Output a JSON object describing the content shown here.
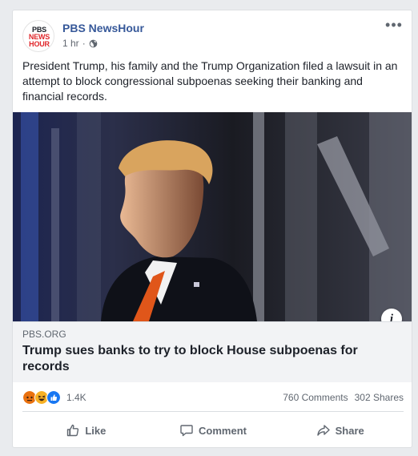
{
  "post": {
    "page_name": "PBS NewsHour",
    "avatar_logo": [
      "PBS",
      "NEWS",
      "HOUR"
    ],
    "time": "1 hr",
    "separator": "·",
    "text": "President Trump, his family and the Trump Organization filed a lawsuit in an attempt to block congressional subpoenas seeking their banking and financial records.",
    "more_icon": "more-horizontal-icon",
    "privacy_icon": "globe-icon"
  },
  "link": {
    "domain": "PBS.ORG",
    "headline": "Trump sues banks to try to block House subpoenas for records",
    "info_label": "i"
  },
  "stats": {
    "reaction_count": "1.4K",
    "reaction_icons": [
      "angry-reaction-icon",
      "haha-reaction-icon",
      "like-reaction-icon"
    ],
    "comments": "760 Comments",
    "shares": "302 Shares"
  },
  "actions": {
    "like": "Like",
    "comment": "Comment",
    "share": "Share"
  },
  "colors": {
    "page_name": "#365899",
    "secondary_text": "#606770",
    "background": "#e9ebee",
    "like_blue": "#1877f2",
    "angry_red": "#e9710f",
    "haha_yellow": "#f7b125"
  }
}
